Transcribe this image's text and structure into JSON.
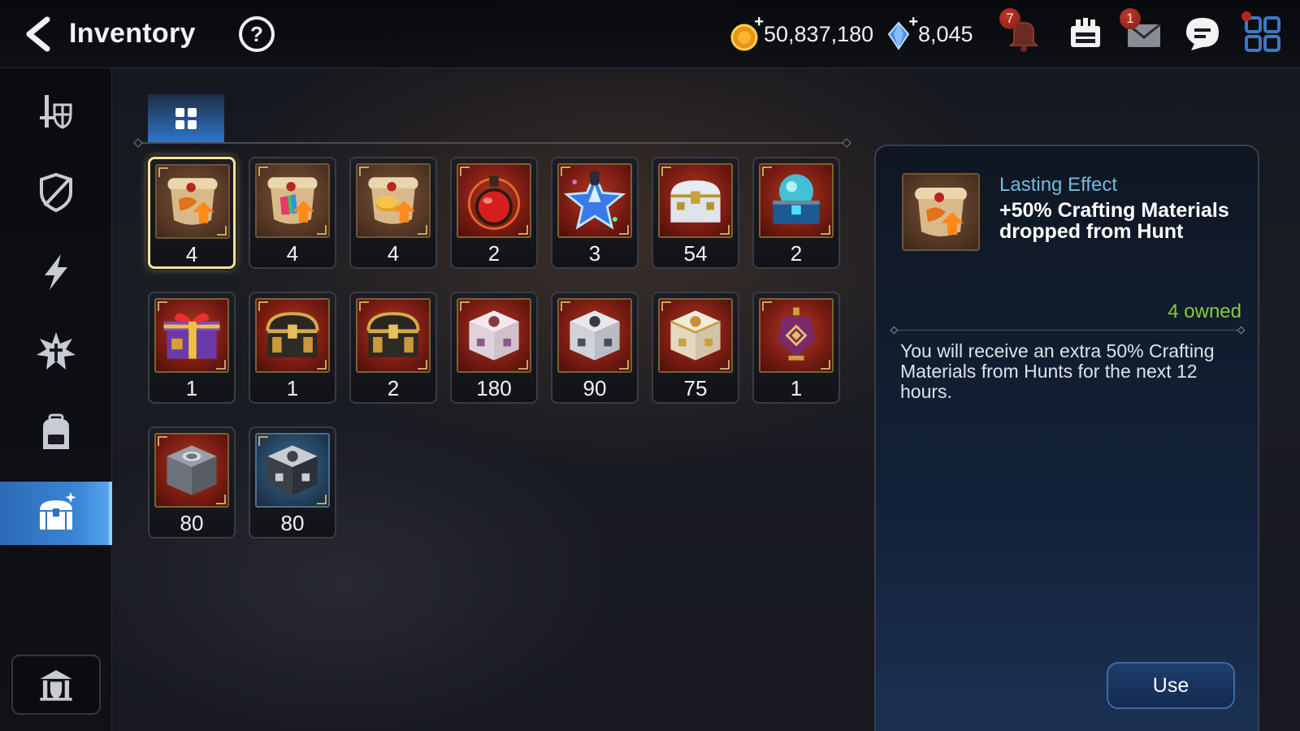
{
  "header": {
    "title": "Inventory",
    "gold": "50,837,180",
    "gems": "8,045",
    "bell_badge": "7",
    "mail_badge": "1"
  },
  "rail": {
    "items": [
      {
        "icon": "hero-equipment-icon"
      },
      {
        "icon": "artifact-shield-icon"
      },
      {
        "icon": "lightning-icon"
      },
      {
        "icon": "catalyst-burst-icon"
      },
      {
        "icon": "backpack-icon"
      },
      {
        "icon": "treasure-chest-icon",
        "active": true
      }
    ],
    "bottom_icon": "guild-storage-icon"
  },
  "filter": {
    "active_tab": "grid-all-icon"
  },
  "items": [
    {
      "name": "Lasting Effect scroll (dragon)",
      "qty": "4",
      "art": "brown",
      "icon": "dragon-scroll-icon",
      "selected": true
    },
    {
      "name": "Lasting Effect scroll (prism)",
      "qty": "4",
      "art": "brown",
      "icon": "prism-scroll-icon"
    },
    {
      "name": "Lasting Effect scroll (gold)",
      "qty": "4",
      "art": "brown",
      "icon": "gold-scroll-icon"
    },
    {
      "name": "Red potion",
      "qty": "2",
      "art": "red",
      "icon": "potion-icon"
    },
    {
      "name": "Star potion",
      "qty": "3",
      "art": "red",
      "icon": "star-potion-icon"
    },
    {
      "name": "White chest",
      "qty": "54",
      "art": "red",
      "icon": "white-chest-icon"
    },
    {
      "name": "Blue orb chest",
      "qty": "2",
      "art": "red",
      "icon": "blue-orb-chest-icon"
    },
    {
      "name": "Gift box",
      "qty": "1",
      "art": "red",
      "icon": "gift-box-icon"
    },
    {
      "name": "Gold treasure chest",
      "qty": "1",
      "art": "red",
      "icon": "gold-chest-icon"
    },
    {
      "name": "Gold treasure chest",
      "qty": "2",
      "art": "red",
      "icon": "gold-chest-icon"
    },
    {
      "name": "Pink box",
      "qty": "180",
      "art": "red",
      "icon": "pink-box-icon"
    },
    {
      "name": "Grey box",
      "qty": "90",
      "art": "red",
      "icon": "grey-box-icon"
    },
    {
      "name": "Gold-trim box",
      "qty": "75",
      "art": "red",
      "icon": "gold-trim-box-icon"
    },
    {
      "name": "Lantern",
      "qty": "1",
      "art": "red",
      "icon": "lantern-icon"
    },
    {
      "name": "Steel box",
      "qty": "80",
      "art": "red",
      "icon": "steel-box-icon"
    },
    {
      "name": "Dark steel box",
      "qty": "80",
      "art": "blue",
      "icon": "dark-steel-box-icon"
    }
  ],
  "detail": {
    "type": "Lasting Effect",
    "name": "+50% Crafting Materials dropped from Hunt",
    "owned": "4 owned",
    "description": "You will receive an extra 50% Crafting Materials from Hunts for the next 12 hours.",
    "use_label": "Use"
  },
  "colors": {
    "accent_blue": "#2f72c4",
    "owned_green": "#86c93b",
    "type_blue": "#76b8dc",
    "selected_border": "#f0e2a0"
  }
}
